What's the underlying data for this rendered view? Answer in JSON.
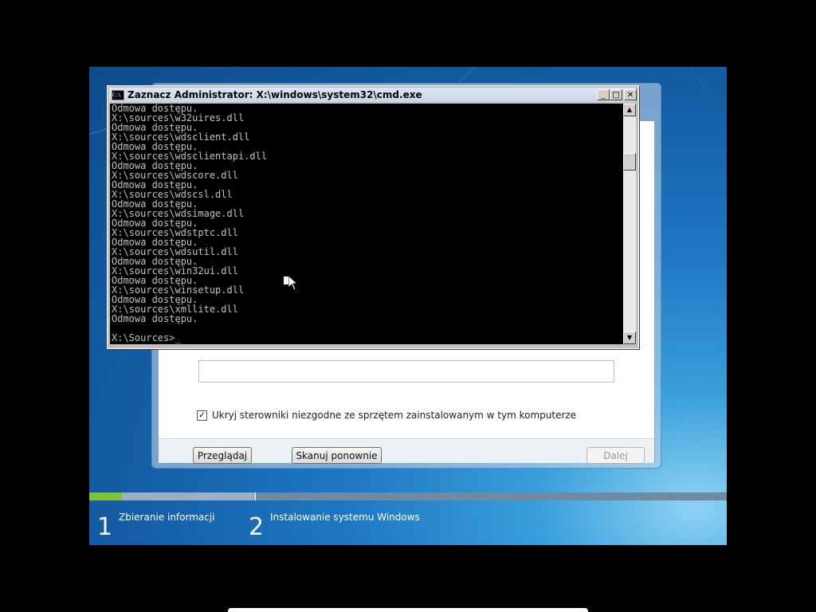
{
  "cmd": {
    "title": "Zaznacz Administrator: X:\\windows\\system32\\cmd.exe",
    "icon_text": "C:\\",
    "controls": {
      "minimize": "_",
      "maximize": "□",
      "close": "✕"
    },
    "lines": [
      "Odmowa dostępu.",
      "X:\\sources\\w32uires.dll",
      "Odmowa dostępu.",
      "X:\\sources\\wdsclient.dll",
      "Odmowa dostępu.",
      "X:\\sources\\wdsclientapi.dll",
      "Odmowa dostępu.",
      "X:\\sources\\wdscore.dll",
      "Odmowa dostępu.",
      "X:\\sources\\wdscsl.dll",
      "Odmowa dostępu.",
      "X:\\sources\\wdsimage.dll",
      "Odmowa dostępu.",
      "X:\\sources\\wdstptc.dll",
      "Odmowa dostępu.",
      "X:\\sources\\wdsutil.dll",
      "Odmowa dostępu.",
      "X:\\sources\\win32ui.dll",
      "Odmowa dostępu.",
      "X:\\sources\\winsetup.dll",
      "Odmowa dostępu.",
      "X:\\sources\\xmllite.dll",
      "Odmowa dostępu.",
      "",
      "X:\\Sources>_"
    ]
  },
  "setup": {
    "hide_checkbox_label": "Ukryj sterowniki niezgodne ze sprzętem zainstalowanym w tym komputerze",
    "hide_checkbox_checked": true,
    "browse_button": "Przeglądaj",
    "rescan_button": "Skanuj ponownie",
    "next_button": "Dalej"
  },
  "progress": {
    "steps": [
      {
        "number": "1",
        "label": "Zbieranie informacji"
      },
      {
        "number": "2",
        "label": "Instalowanie systemu Windows"
      }
    ],
    "step1_fill_fraction": 0.2
  }
}
